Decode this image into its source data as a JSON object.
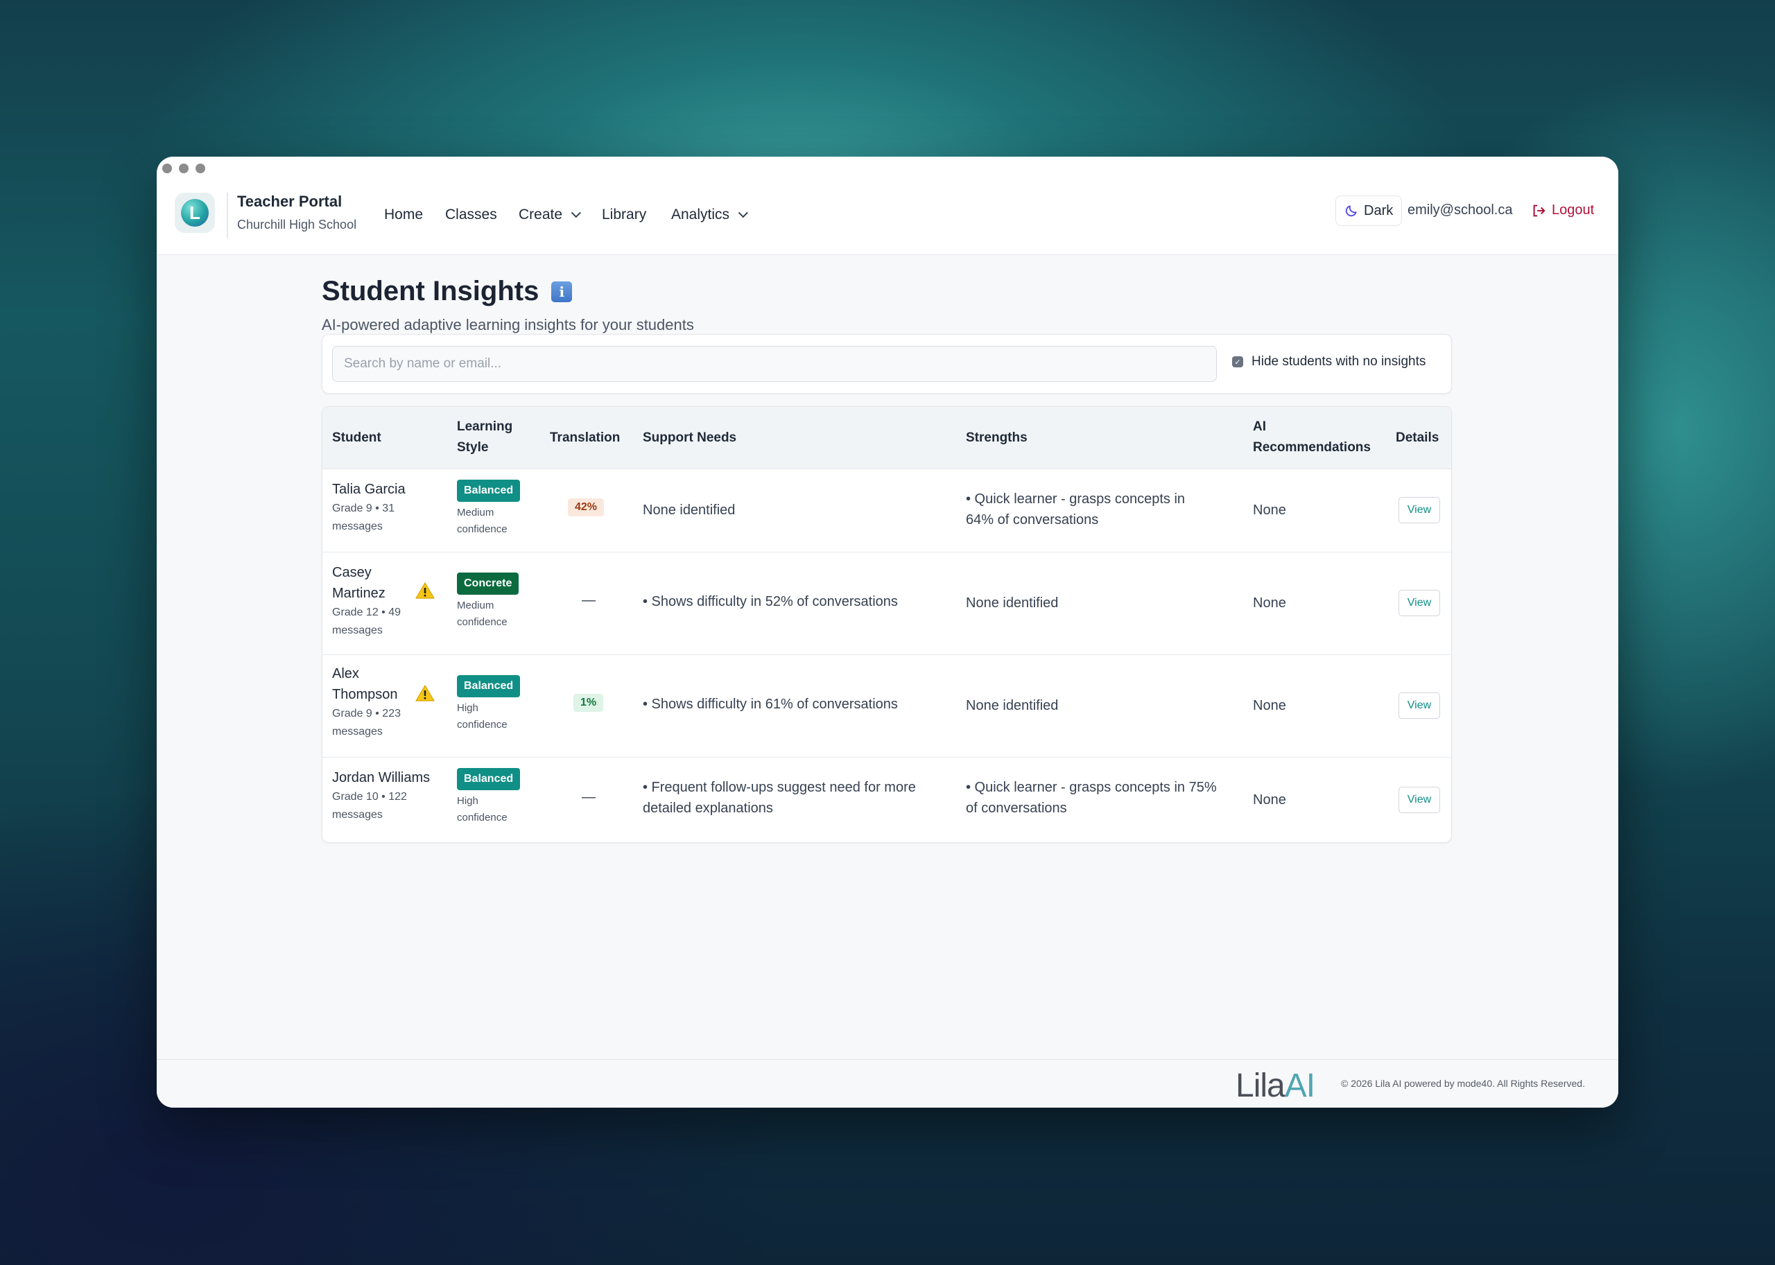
{
  "brand": {
    "title": "Teacher Portal",
    "school": "Churchill High School",
    "logo_letter": "L"
  },
  "nav": {
    "home": "Home",
    "classes": "Classes",
    "create": "Create",
    "library": "Library",
    "analytics": "Analytics"
  },
  "header_right": {
    "dark_label": "Dark",
    "email": "emily@school.ca",
    "logout_label": "Logout"
  },
  "page": {
    "title": "Student Insights",
    "info_glyph": "i",
    "subtitle": "AI-powered adaptive learning insights for your students"
  },
  "search": {
    "placeholder": "Search by name or email..."
  },
  "filter": {
    "hide_label": "Hide students with no insights",
    "checked": true
  },
  "table": {
    "headers": {
      "student": "Student",
      "learning_style_1": "Learning",
      "learning_style_2": "Style",
      "translation": "Translation",
      "support": "Support Needs",
      "strengths": "Strengths",
      "ai_1": "AI",
      "ai_2": "Recommendations",
      "details": "Details"
    },
    "rows": [
      {
        "name_1": "Talia Garcia",
        "name_2": "",
        "meta_1": "Grade 9 • 31",
        "meta_2": "messages",
        "warning": false,
        "style": "Balanced",
        "style_color": "#0f8f85",
        "conf_1": "Medium",
        "conf_2": "confidence",
        "translation": "42%",
        "support": "None identified",
        "strengths_1": "• Quick learner - grasps concepts in",
        "strengths_2": "64% of conversations",
        "ai": "None",
        "view": "View"
      },
      {
        "name_1": "Casey",
        "name_2": "Martinez",
        "meta_1": "Grade 12 • 49",
        "meta_2": "messages",
        "warning": true,
        "style": "Concrete",
        "style_color": "#0b6b3f",
        "conf_1": "Medium",
        "conf_2": "confidence",
        "translation": "—",
        "support": "• Shows difficulty in 52% of conversations",
        "strengths_1": "None identified",
        "strengths_2": "",
        "ai": "None",
        "view": "View"
      },
      {
        "name_1": "Alex",
        "name_2": "Thompson",
        "meta_1": "Grade 9 • 223",
        "meta_2": "messages",
        "warning": true,
        "style": "Balanced",
        "style_color": "#0f8f85",
        "conf_1": "High",
        "conf_2": "confidence",
        "translation": "1%",
        "support": "• Shows difficulty in 61% of conversations",
        "strengths_1": "None identified",
        "strengths_2": "",
        "ai": "None",
        "view": "View"
      },
      {
        "name_1": "Jordan Williams",
        "name_2": "",
        "meta_1": "Grade 10 • 122",
        "meta_2": "messages",
        "warning": false,
        "style": "Balanced",
        "style_color": "#0f8f85",
        "conf_1": "High",
        "conf_2": "confidence",
        "translation": "—",
        "support_1": "• Frequent follow-ups suggest need for more",
        "support_2": "detailed explanations",
        "strengths_1": "• Quick learner - grasps concepts in 75%",
        "strengths_2": "of conversations",
        "ai": "None",
        "view": "View"
      }
    ]
  },
  "footer": {
    "logo_part1": "Lila",
    "logo_part2": "AI",
    "copyright": "© 2026 Lila AI powered by mode40. All Rights Reserved."
  },
  "colors": {
    "accent": "#0f8f85",
    "logout": "#b0123a",
    "translation_high_bg": "#fbe8dd",
    "translation_high_fg": "#9a3d12",
    "translation_low_bg": "#dff3e7",
    "translation_low_fg": "#137a3f"
  }
}
